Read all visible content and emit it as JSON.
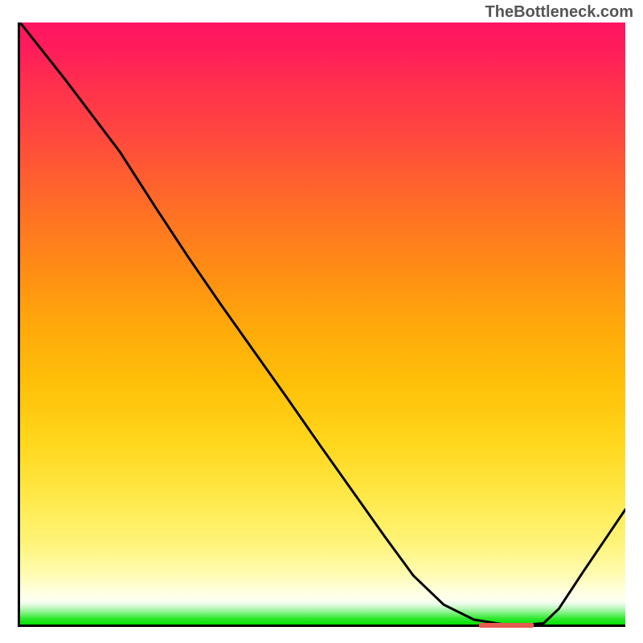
{
  "watermark": "TheBottleneck.com",
  "chart_data": {
    "type": "line",
    "title": "",
    "xlabel": "",
    "ylabel": "",
    "xlim": [
      0,
      100
    ],
    "ylim": [
      0,
      100
    ],
    "background_gradient": {
      "direction": "vertical",
      "stops": [
        {
          "pos": 0.0,
          "color": "#03e103"
        },
        {
          "pos": 0.05,
          "color": "#feffdf"
        },
        {
          "pos": 0.5,
          "color": "#ffa80b"
        },
        {
          "pos": 1.0,
          "color": "#ff1562"
        }
      ]
    },
    "curve_color": "#000000",
    "curve_points_xy": [
      [
        0.0,
        100.0
      ],
      [
        7.4,
        90.6
      ],
      [
        16.5,
        78.5
      ],
      [
        22.5,
        69.1
      ],
      [
        27.6,
        61.3
      ],
      [
        33.0,
        53.4
      ],
      [
        38.5,
        45.6
      ],
      [
        44.0,
        37.8
      ],
      [
        49.4,
        30.0
      ],
      [
        54.9,
        22.2
      ],
      [
        60.4,
        14.4
      ],
      [
        65.0,
        8.1
      ],
      [
        70.0,
        3.3
      ],
      [
        75.0,
        0.8
      ],
      [
        80.0,
        0.0
      ],
      [
        84.0,
        0.0
      ],
      [
        86.5,
        0.2
      ],
      [
        89.0,
        2.6
      ],
      [
        93.0,
        8.7
      ],
      [
        100.0,
        19.1
      ]
    ],
    "minimum_marker": {
      "x_range": [
        75.5,
        84.5
      ],
      "y": 0.25,
      "color": "#e55b4e"
    },
    "legend": false,
    "grid": false
  }
}
